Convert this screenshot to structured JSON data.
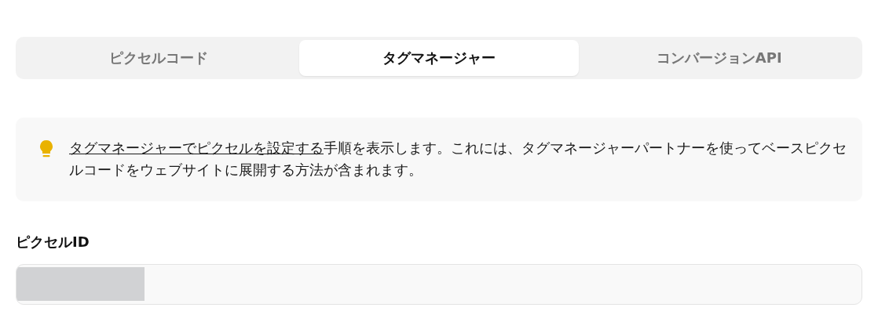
{
  "tabs": [
    {
      "label": "ピクセルコード",
      "selected": false
    },
    {
      "label": "タグマネージャー",
      "selected": true
    },
    {
      "label": "コンバージョンAPI",
      "selected": false
    }
  ],
  "info": {
    "link": "タグマネージャーでピクセルを設定する",
    "text": "手順を表示します。これには、タグマネージャーパートナーを使ってベースピクセルコードをウェブサイトに展開する方法が含まれます。"
  },
  "pixel_id": {
    "label": "ピクセルID",
    "redacted": true
  }
}
